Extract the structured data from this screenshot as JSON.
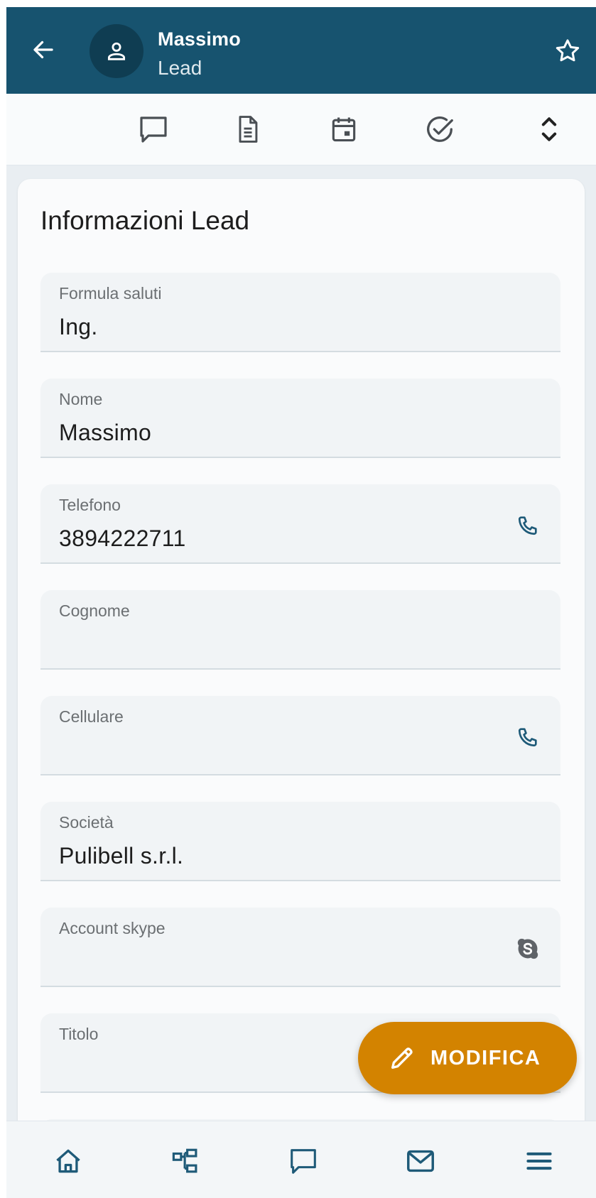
{
  "header": {
    "name": "Massimo",
    "subtitle": "Lead",
    "back_icon": "arrow-left-icon",
    "avatar_icon": "person-icon",
    "favorite_icon": "star-outline-icon"
  },
  "action_bar": {
    "items": [
      {
        "icon": "chat-bubble-icon"
      },
      {
        "icon": "document-icon"
      },
      {
        "icon": "calendar-icon"
      },
      {
        "icon": "check-circle-icon"
      },
      {
        "icon": "unfold-icon"
      }
    ]
  },
  "card": {
    "title": "Informazioni Lead",
    "fields": [
      {
        "label": "Formula saluti",
        "value": "Ing."
      },
      {
        "label": "Nome",
        "value": "Massimo"
      },
      {
        "label": "Telefono",
        "value": "3894222711",
        "icon": "phone-icon"
      },
      {
        "label": "Cognome",
        "value": ""
      },
      {
        "label": "Cellulare",
        "value": "",
        "icon": "phone-icon"
      },
      {
        "label": "Società",
        "value": "Pulibell s.r.l."
      },
      {
        "label": "Account skype",
        "value": "",
        "icon": "skype-icon"
      },
      {
        "label": "Titolo",
        "value": ""
      }
    ]
  },
  "fab": {
    "label": "MODIFICA",
    "icon": "pencil-icon"
  },
  "bottom_nav": {
    "items": [
      {
        "icon": "home-icon"
      },
      {
        "icon": "hierarchy-icon"
      },
      {
        "icon": "chat-bubble-icon"
      },
      {
        "icon": "mail-icon"
      },
      {
        "icon": "menu-icon"
      }
    ]
  },
  "colors": {
    "primary": "#17536f",
    "accent": "#d38300",
    "icon": "#4a4f54",
    "link_icon": "#1e5a78"
  }
}
